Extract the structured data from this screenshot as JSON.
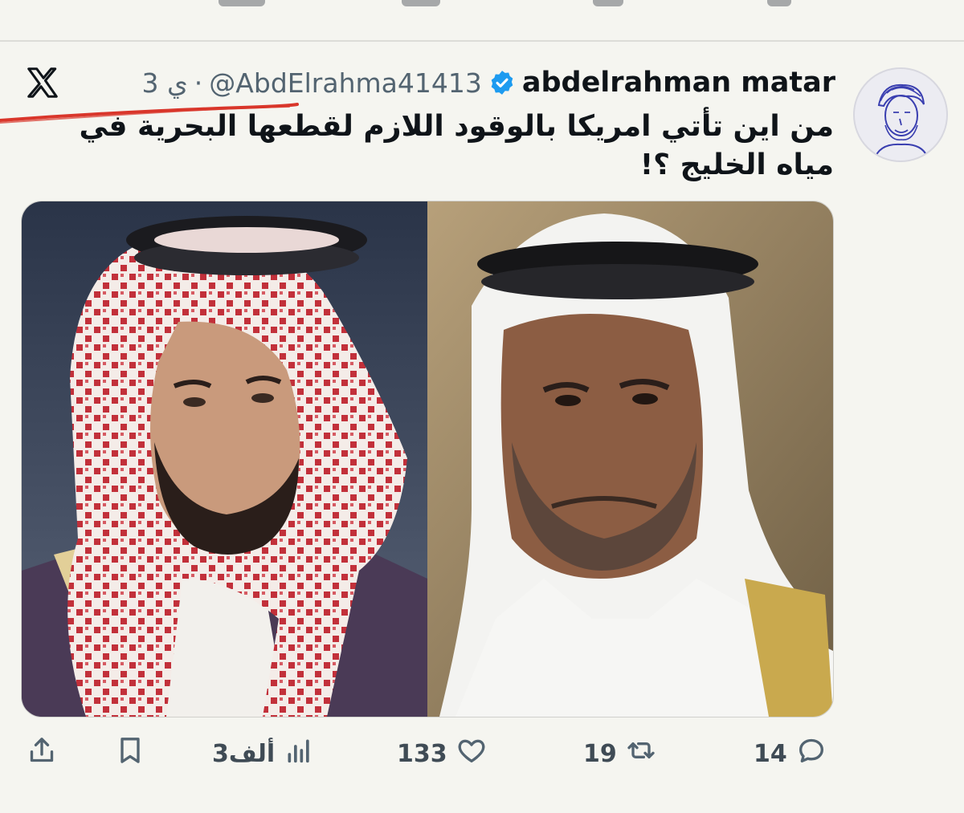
{
  "tweet": {
    "display_name": "abdelrahman matar",
    "handle": "@AbdElrahma41413",
    "separator": "·",
    "time": "3 ي",
    "text": "من اين تأتي امريكا بالوقود اللازم لقطعها البحرية في مياه الخليج ؟!"
  },
  "icons": {
    "verified": "verified-badge-icon",
    "platform": "x-logo-icon",
    "reply": "reply-icon",
    "retweet": "retweet-icon",
    "like": "heart-icon",
    "views": "views-icon",
    "bookmark": "bookmark-icon",
    "share": "share-icon"
  },
  "actions": {
    "reply_count": "14",
    "retweet_count": "19",
    "like_count": "133",
    "views_count": "3ألف"
  },
  "colors": {
    "verified": "#1d9bf0",
    "annotation_red": "#d9362b",
    "text_secondary": "#536471"
  }
}
